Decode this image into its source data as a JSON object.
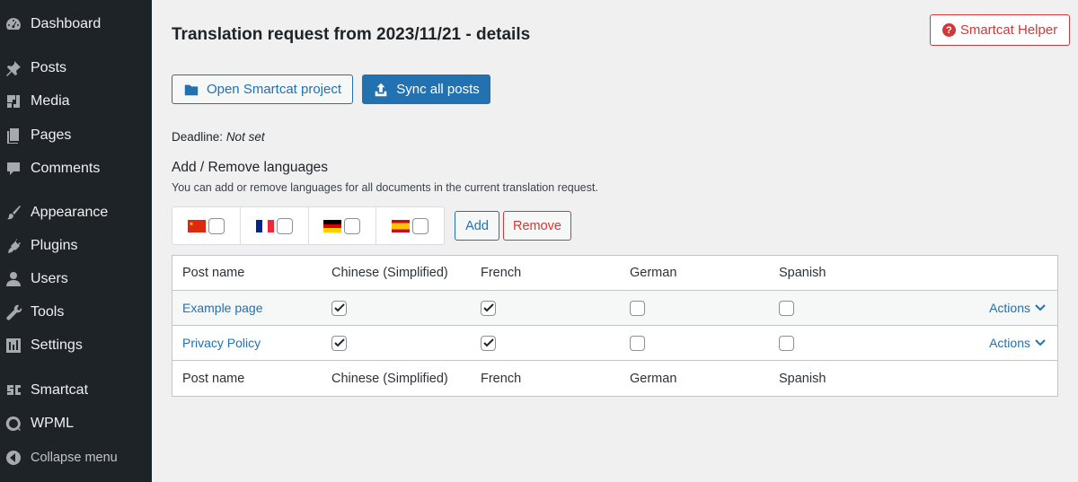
{
  "sidebar": {
    "items": [
      {
        "label": "Dashboard",
        "icon": "dashboard-icon"
      },
      {
        "label": "Posts",
        "icon": "pin-icon"
      },
      {
        "label": "Media",
        "icon": "media-icon"
      },
      {
        "label": "Pages",
        "icon": "pages-icon"
      },
      {
        "label": "Comments",
        "icon": "comment-icon"
      },
      {
        "label": "Appearance",
        "icon": "brush-icon"
      },
      {
        "label": "Plugins",
        "icon": "plug-icon"
      },
      {
        "label": "Users",
        "icon": "user-icon"
      },
      {
        "label": "Tools",
        "icon": "wrench-icon"
      },
      {
        "label": "Settings",
        "icon": "settings-icon"
      },
      {
        "label": "Smartcat",
        "icon": "smartcat-icon"
      },
      {
        "label": "WPML",
        "icon": "wpml-icon"
      }
    ],
    "collapse_label": "Collapse menu"
  },
  "header": {
    "title": "Translation request from 2023/11/21 - details",
    "helper_button": "Smartcat Helper"
  },
  "toolbar": {
    "open_label": "Open Smartcat project",
    "sync_label": "Sync all posts"
  },
  "deadline": {
    "label": "Deadline:",
    "value": "Not set"
  },
  "languages_section": {
    "title": "Add / Remove languages",
    "description": "You can add or remove languages for all documents in the current translation request.",
    "flags": [
      {
        "lang": "chinese",
        "icon": "china-flag-icon",
        "checked": false
      },
      {
        "lang": "french",
        "icon": "france-flag-icon",
        "checked": false
      },
      {
        "lang": "german",
        "icon": "germany-flag-icon",
        "checked": false
      },
      {
        "lang": "spanish",
        "icon": "spain-flag-icon",
        "checked": false
      }
    ],
    "add_label": "Add",
    "remove_label": "Remove"
  },
  "table": {
    "columns": [
      "Post name",
      "Chinese (Simplified)",
      "French",
      "German",
      "Spanish"
    ],
    "rows": [
      {
        "name": "Example page",
        "checks": [
          true,
          true,
          false,
          false
        ],
        "actions": "Actions"
      },
      {
        "name": "Privacy Policy",
        "checks": [
          true,
          true,
          false,
          false
        ],
        "actions": "Actions"
      }
    ]
  },
  "colors": {
    "sidebar_bg": "#1d2327",
    "accent": "#2271b1",
    "danger": "#d63638",
    "page_bg": "#f0f0f1"
  }
}
